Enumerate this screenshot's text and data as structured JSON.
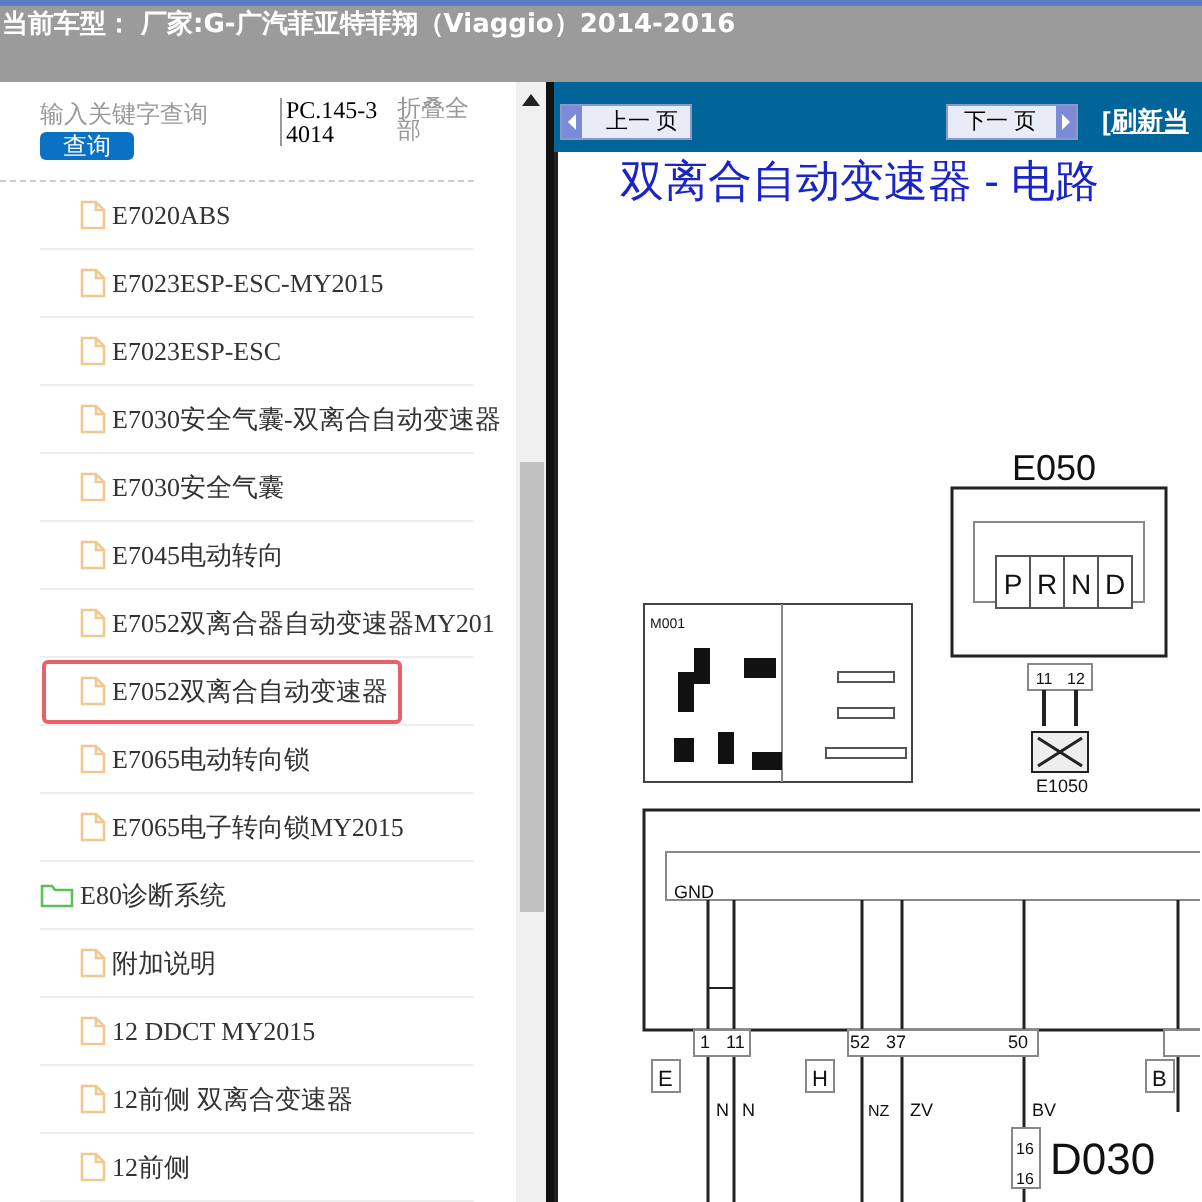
{
  "header": {
    "title": "当前车型： 厂家:G-广汽菲亚特菲翔（Viaggio）2014-2016"
  },
  "sidebar": {
    "search": {
      "placeholder": "输入关键字查询",
      "button": "查询"
    },
    "code": "PC.145-34014",
    "collapse": "折叠全部",
    "tree": [
      {
        "kind": "file",
        "label": "E7020ABS",
        "selected": false
      },
      {
        "kind": "file",
        "label": "E7023ESP-ESC-MY2015",
        "selected": false
      },
      {
        "kind": "file",
        "label": "E7023ESP-ESC",
        "selected": false
      },
      {
        "kind": "file",
        "label": "E7030安全气囊-双离合自动变速器",
        "selected": false
      },
      {
        "kind": "file",
        "label": "E7030安全气囊",
        "selected": false
      },
      {
        "kind": "file",
        "label": "E7045电动转向",
        "selected": false
      },
      {
        "kind": "file",
        "label": "E7052双离合器自动变速器MY201",
        "selected": false
      },
      {
        "kind": "file",
        "label": "E7052双离合自动变速器",
        "selected": true
      },
      {
        "kind": "file",
        "label": "E7065电动转向锁",
        "selected": false
      },
      {
        "kind": "file",
        "label": "E7065电子转向锁MY2015",
        "selected": false
      },
      {
        "kind": "folder",
        "label": "E80诊断系统",
        "selected": false,
        "children": [
          {
            "kind": "file",
            "label": "附加说明",
            "selected": false
          },
          {
            "kind": "file",
            "label": "12 DDCT MY2015",
            "selected": false
          },
          {
            "kind": "file",
            "label": "12前侧 双离合变速器",
            "selected": false
          },
          {
            "kind": "file",
            "label": "12前侧",
            "selected": false
          }
        ]
      }
    ]
  },
  "viewer": {
    "prev": "上一 页",
    "next": "下一 页",
    "refresh": "[刷新当",
    "heading": "双离合自动变速器 - 电路",
    "diagram_labels": [
      "E050",
      "P",
      "R",
      "N",
      "D",
      "11",
      "12",
      "M001",
      "E1050",
      "GND",
      "1",
      "11",
      "52",
      "37",
      "50",
      "E",
      "H",
      "B",
      "N",
      "N",
      "NZ",
      "ZV",
      "BV",
      "16",
      "16",
      "D030"
    ]
  }
}
